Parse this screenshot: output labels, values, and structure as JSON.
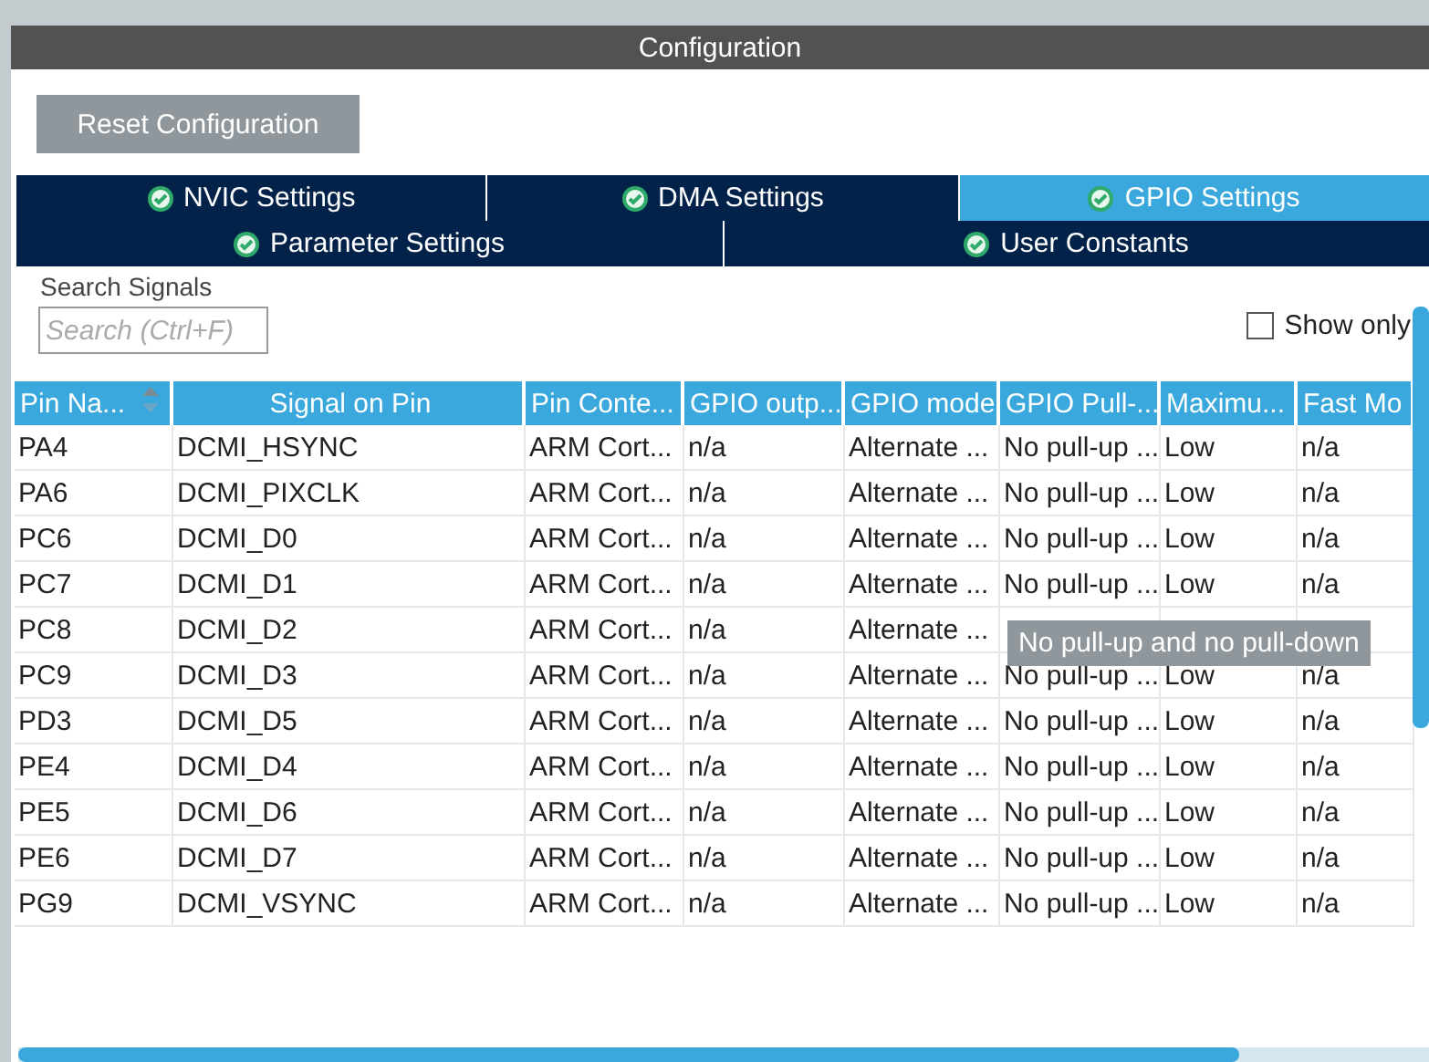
{
  "panel": {
    "title": "Configuration"
  },
  "reset_button": "Reset Configuration",
  "tabs": [
    [
      {
        "label": "NVIC Settings",
        "selected": false
      },
      {
        "label": "DMA Settings",
        "selected": false
      },
      {
        "label": "GPIO Settings",
        "selected": true
      }
    ],
    [
      {
        "label": "Parameter Settings",
        "selected": false
      },
      {
        "label": "User Constants",
        "selected": false
      }
    ]
  ],
  "search": {
    "label": "Search Signals",
    "placeholder": "Search (Ctrl+F)"
  },
  "show_only": {
    "label": "Show only",
    "checked": false
  },
  "table": {
    "columns": [
      "Pin Na...",
      "Signal on Pin",
      "Pin Conte...",
      "GPIO outp...",
      "GPIO mode",
      "GPIO Pull-...",
      "Maximu...",
      "Fast Mo"
    ],
    "rows": [
      [
        "PA4",
        "DCMI_HSYNC",
        "ARM Cort...",
        "n/a",
        "Alternate ...",
        "No pull-up ...",
        "Low",
        "n/a"
      ],
      [
        "PA6",
        "DCMI_PIXCLK",
        "ARM Cort...",
        "n/a",
        "Alternate ...",
        "No pull-up ...",
        "Low",
        "n/a"
      ],
      [
        "PC6",
        "DCMI_D0",
        "ARM Cort...",
        "n/a",
        "Alternate ...",
        "No pull-up ...",
        "Low",
        "n/a"
      ],
      [
        "PC7",
        "DCMI_D1",
        "ARM Cort...",
        "n/a",
        "Alternate ...",
        "No pull-up ...",
        "Low",
        "n/a"
      ],
      [
        "PC8",
        "DCMI_D2",
        "ARM Cort...",
        "n/a",
        "Alternate ...",
        null,
        null,
        null
      ],
      [
        "PC9",
        "DCMI_D3",
        "ARM Cort...",
        "n/a",
        "Alternate ...",
        "No pull-up ...",
        "Low",
        "n/a"
      ],
      [
        "PD3",
        "DCMI_D5",
        "ARM Cort...",
        "n/a",
        "Alternate ...",
        "No pull-up ...",
        "Low",
        "n/a"
      ],
      [
        "PE4",
        "DCMI_D4",
        "ARM Cort...",
        "n/a",
        "Alternate ...",
        "No pull-up ...",
        "Low",
        "n/a"
      ],
      [
        "PE5",
        "DCMI_D6",
        "ARM Cort...",
        "n/a",
        "Alternate ...",
        "No pull-up ...",
        "Low",
        "n/a"
      ],
      [
        "PE6",
        "DCMI_D7",
        "ARM Cort...",
        "n/a",
        "Alternate ...",
        "No pull-up ...",
        "Low",
        "n/a"
      ],
      [
        "PG9",
        "DCMI_VSYNC",
        "ARM Cort...",
        "n/a",
        "Alternate ...",
        "No pull-up ...",
        "Low",
        "n/a"
      ]
    ]
  },
  "tooltip": "No pull-up and no pull-down"
}
